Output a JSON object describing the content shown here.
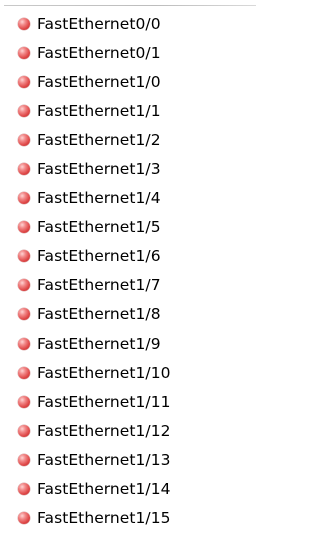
{
  "status_color": "#e04a4a",
  "interfaces": [
    {
      "label": "FastEthernet0/0",
      "status_icon": "status-down-icon"
    },
    {
      "label": "FastEthernet0/1",
      "status_icon": "status-down-icon"
    },
    {
      "label": "FastEthernet1/0",
      "status_icon": "status-down-icon"
    },
    {
      "label": "FastEthernet1/1",
      "status_icon": "status-down-icon"
    },
    {
      "label": "FastEthernet1/2",
      "status_icon": "status-down-icon"
    },
    {
      "label": "FastEthernet1/3",
      "status_icon": "status-down-icon"
    },
    {
      "label": "FastEthernet1/4",
      "status_icon": "status-down-icon"
    },
    {
      "label": "FastEthernet1/5",
      "status_icon": "status-down-icon"
    },
    {
      "label": "FastEthernet1/6",
      "status_icon": "status-down-icon"
    },
    {
      "label": "FastEthernet1/7",
      "status_icon": "status-down-icon"
    },
    {
      "label": "FastEthernet1/8",
      "status_icon": "status-down-icon"
    },
    {
      "label": "FastEthernet1/9",
      "status_icon": "status-down-icon"
    },
    {
      "label": "FastEthernet1/10",
      "status_icon": "status-down-icon"
    },
    {
      "label": "FastEthernet1/11",
      "status_icon": "status-down-icon"
    },
    {
      "label": "FastEthernet1/12",
      "status_icon": "status-down-icon"
    },
    {
      "label": "FastEthernet1/13",
      "status_icon": "status-down-icon"
    },
    {
      "label": "FastEthernet1/14",
      "status_icon": "status-down-icon"
    },
    {
      "label": "FastEthernet1/15",
      "status_icon": "status-down-icon"
    }
  ]
}
